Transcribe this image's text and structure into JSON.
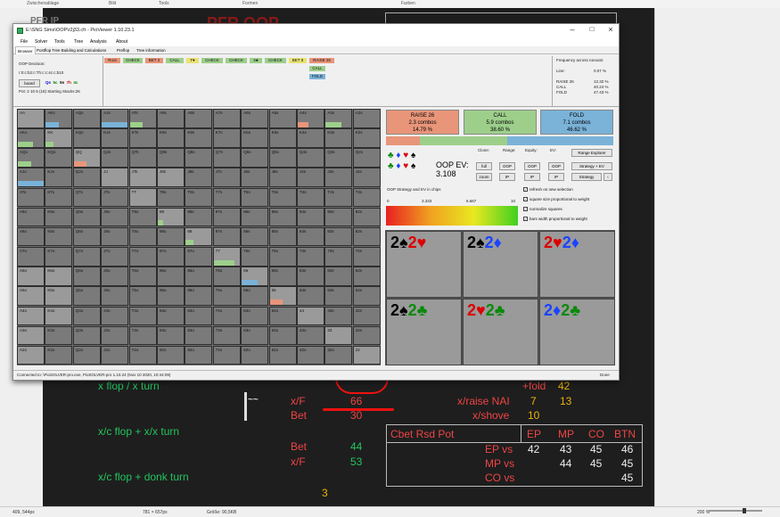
{
  "topbar": {
    "items": [
      "Zwischenablage",
      "Bild",
      "Tools",
      "Formen",
      "Farben"
    ]
  },
  "background": {
    "title": "PFR OOP",
    "left_label": "PFR IP"
  },
  "window": {
    "title": "E:\\SNG Sims\\OOP\\r2j33.cfr - PioViewer 1.10.23.1",
    "menu": [
      "File",
      "Solver",
      "Tools",
      "Tree",
      "Analysis",
      "About"
    ],
    "tabs": [
      "Browser",
      "Postflop Tree Building and Calculations",
      "Preflop",
      "Tree information"
    ],
    "oop_decision": "OOP Decision:",
    "board_line": "r:0:c:b2:c:Th:c:c:4c:c:b10",
    "board_btn": "board",
    "board_cards": [
      "Qs",
      "5c",
      "5s",
      "7h",
      "4c"
    ],
    "pot_line": "Pot: 2 10 6 (18) Starting Stacks:26",
    "action_tree": {
      "row1": [
        "Root",
        "CHECK",
        "BET 2",
        "CALL",
        "T♥",
        "CHECK",
        "CHECK",
        "4♣",
        "CHECK",
        "BET 8",
        "RAISE 26"
      ],
      "row2": [
        "CALL"
      ],
      "row3": [
        "FOLD"
      ]
    },
    "freq": {
      "title": "Frequency across runouts:",
      "rows": [
        {
          "label": "Line:",
          "value": "0.07 %"
        },
        {
          "label": "RAISE 26",
          "value": "12.32 %"
        },
        {
          "label": "CALL",
          "value": "40.24 %"
        },
        {
          "label": "FOLD",
          "value": "47.43 %"
        }
      ]
    },
    "grid_rows": [
      [
        "AA",
        "AKs",
        "AQs",
        "AJs",
        "ATs",
        "A9s",
        "A8s",
        "A7s",
        "A6s",
        "A5s",
        "A4s",
        "A3s",
        "A2s"
      ],
      [
        "AKo",
        "KK",
        "KQs",
        "KJs",
        "KTs",
        "K9s",
        "K8s",
        "K7s",
        "K6s",
        "K5s",
        "K4s",
        "K3s",
        "K2s"
      ],
      [
        "AQo",
        "KQo",
        "QQ",
        "QJs",
        "QTs",
        "Q9s",
        "Q8s",
        "Q7s",
        "Q6s",
        "Q5s",
        "Q4s",
        "Q3s",
        "Q2s"
      ],
      [
        "AJo",
        "KJo",
        "QJo",
        "JJ",
        "JTs",
        "J9s",
        "J8s",
        "J7s",
        "J6s",
        "J5s",
        "J4s",
        "J3s",
        "J2s"
      ],
      [
        "ATo",
        "KTo",
        "QTo",
        "JTo",
        "TT",
        "T9s",
        "T8s",
        "T7s",
        "T6s",
        "T5s",
        "T4s",
        "T3s",
        "T2s"
      ],
      [
        "A9o",
        "K9o",
        "Q9o",
        "J9o",
        "T9o",
        "99",
        "98s",
        "97s",
        "96s",
        "95s",
        "94s",
        "93s",
        "92s"
      ],
      [
        "A8o",
        "K8o",
        "Q8o",
        "J8o",
        "T8o",
        "98o",
        "88",
        "87s",
        "86s",
        "85s",
        "84s",
        "83s",
        "82s"
      ],
      [
        "A7o",
        "K7o",
        "Q7o",
        "J7o",
        "T7o",
        "97o",
        "87o",
        "77",
        "76s",
        "75s",
        "74s",
        "73s",
        "72s"
      ],
      [
        "A6o",
        "K6o",
        "Q6o",
        "J6o",
        "T6o",
        "96o",
        "86o",
        "76o",
        "66",
        "65s",
        "64s",
        "63s",
        "62s"
      ],
      [
        "A5o",
        "K5o",
        "Q5o",
        "J5o",
        "T5o",
        "95o",
        "85o",
        "75o",
        "65o",
        "55",
        "54s",
        "53s",
        "52s"
      ],
      [
        "A4o",
        "K4o",
        "Q4o",
        "J4o",
        "T4o",
        "94o",
        "84o",
        "74o",
        "64o",
        "54o",
        "44",
        "43s",
        "42s"
      ],
      [
        "A3o",
        "K3o",
        "Q3o",
        "J3o",
        "T3o",
        "93o",
        "83o",
        "73o",
        "63o",
        "53o",
        "43o",
        "33",
        "32s"
      ],
      [
        "A2o",
        "K2o",
        "Q2o",
        "J2o",
        "T2o",
        "92o",
        "82o",
        "72o",
        "62o",
        "52o",
        "42o",
        "32o",
        "22"
      ]
    ],
    "strategy": [
      {
        "name": "RAISE 26",
        "combos": "2.3 combos",
        "pct": "14.79 %",
        "color": "#e8957a"
      },
      {
        "name": "CALL",
        "combos": "5.9 combos",
        "pct": "38.60 %",
        "color": "#9dcf8b"
      },
      {
        "name": "FOLD",
        "combos": "7.1 combos",
        "pct": "46.62 %",
        "color": "#7ab2d8"
      }
    ],
    "strategy_fraction": {
      "raise": 0.1479,
      "call": 0.386,
      "fold": 0.4662
    },
    "ev": {
      "label": "OOP EV:",
      "value": "3.108"
    },
    "controls": {
      "clone": "Clone:",
      "range": "Range:",
      "equity": "Equity:",
      "ev": "EV:",
      "full": "full",
      "zoom": "zoom",
      "oop": "OOP",
      "ip": "IP",
      "range_explorer": "Range Explorer",
      "strategy_ev": "Strategy + EV",
      "strategy": "Strategy"
    },
    "legend": {
      "title": "OOP Strategy and EV in chips",
      "ticks": [
        "0",
        "3.333",
        "6.667",
        "10"
      ]
    },
    "checks": [
      "refresh on new selection",
      "square size proportional to weight",
      "normalize squares",
      "bars width proportional to weight"
    ],
    "combos": [
      [
        {
          "r": "2",
          "s": "♠",
          "c": "sp"
        },
        {
          "r": "2",
          "s": "♥",
          "c": "ht"
        }
      ],
      [
        {
          "r": "2",
          "s": "♠",
          "c": "sp"
        },
        {
          "r": "2",
          "s": "♦",
          "c": "dm"
        }
      ],
      [
        {
          "r": "2",
          "s": "♥",
          "c": "ht"
        },
        {
          "r": "2",
          "s": "♦",
          "c": "dm"
        }
      ],
      [
        {
          "r": "2",
          "s": "♠",
          "c": "sp"
        },
        {
          "r": "2",
          "s": "♣",
          "c": "cl"
        }
      ],
      [
        {
          "r": "2",
          "s": "♥",
          "c": "ht"
        },
        {
          "r": "2",
          "s": "♣",
          "c": "cl"
        }
      ],
      [
        {
          "r": "2",
          "s": "♦",
          "c": "dm"
        },
        {
          "r": "2",
          "s": "♣",
          "c": "cl"
        }
      ]
    ],
    "status": "Connected to: \\PioSOLVER-pro.exe, PioSOLVER-pro 1.10.24 (Nov 10 2020, 10:44:09)",
    "done": "Done"
  },
  "notes": {
    "xflop": "x flop / x turn",
    "xcx": "x/c flop + x/x turn",
    "xcdonk": "x/c flop + donk turn",
    "xf": "x/F",
    "xf_val": "66",
    "bet": "Bet",
    "bet_val": "30",
    "bet2": "Bet",
    "bet2_val": "44",
    "xf2": "x/F",
    "xf2_val": "53",
    "three": "3",
    "fold": "+fold",
    "fold_val": "42",
    "xraise": "x/raise NAI",
    "xraise_a": "7",
    "xraise_b": "13",
    "xshove": "x/shove",
    "xshove_val": "10"
  },
  "cbet_table": {
    "title": "Cbet Rsd Pot",
    "cols": [
      "EP",
      "MP",
      "CO",
      "BTN"
    ],
    "rows": [
      {
        "label": "EP vs",
        "vals": [
          "42",
          "43",
          "45",
          "46"
        ]
      },
      {
        "label": "MP vs",
        "vals": [
          "",
          "44",
          "45",
          "45"
        ]
      },
      {
        "label": "CO vs",
        "vals": [
          "",
          "",
          "",
          "45"
        ]
      }
    ]
  },
  "statusbar": {
    "pos": "409, 544px",
    "sel": "781 × 657px",
    "size": "Größe: 90,5KB",
    "zoom": "200 %"
  }
}
